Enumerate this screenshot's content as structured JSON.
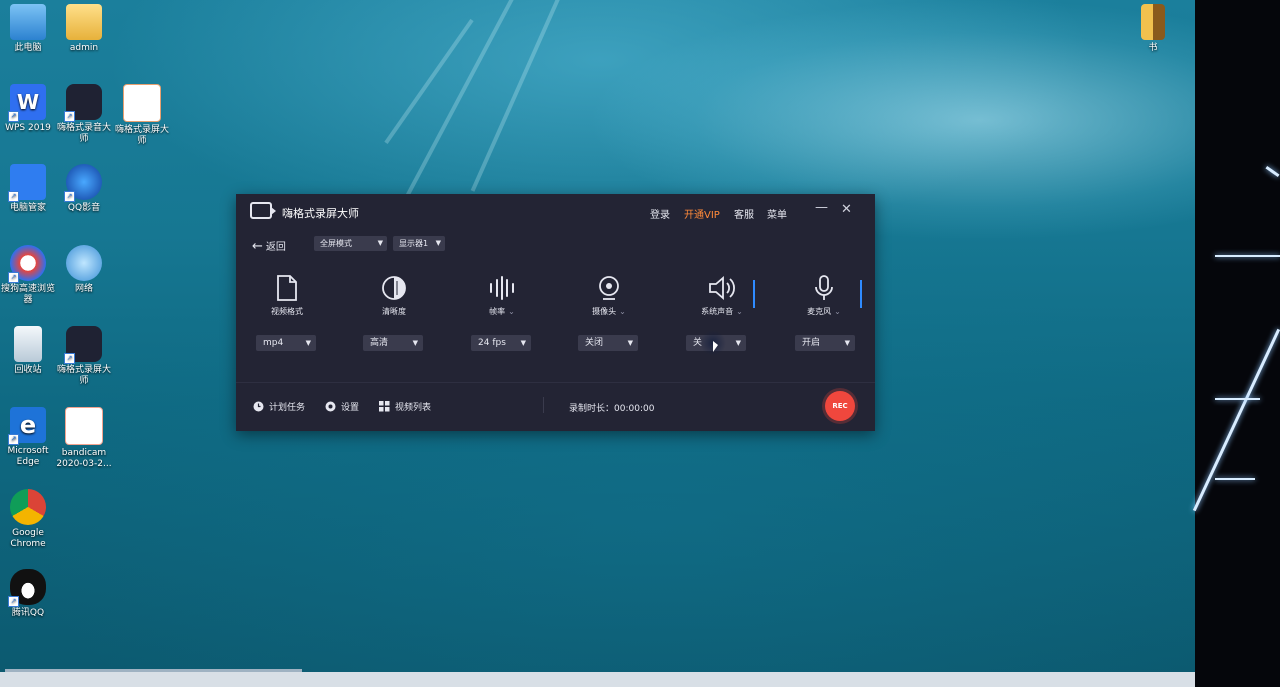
{
  "desktop": {
    "icons": [
      {
        "label": "此电脑",
        "name": "this-pc-icon",
        "color": "#4aa3f0"
      },
      {
        "label": "admin",
        "name": "user-folder-icon",
        "color": "#f2c14e"
      },
      {
        "label": "WPS 2019",
        "name": "wps-icon",
        "color": "#2f6ff0"
      },
      {
        "label": "嗨格式录音大师",
        "name": "audio-recorder-icon",
        "color": "#1f2233"
      },
      {
        "label": "嗨格式录屏大师",
        "name": "pdf-file-icon",
        "color": "#ffffff"
      },
      {
        "label": "电脑管家",
        "name": "pc-manager-icon",
        "color": "#2f7df0"
      },
      {
        "label": "QQ影音",
        "name": "qq-player-icon",
        "color": "#1a5fd6"
      },
      {
        "label": "搜狗高速浏览器",
        "name": "sogou-browser-icon",
        "color": "#e8453c"
      },
      {
        "label": "网络",
        "name": "network-icon",
        "color": "#5bb6f0"
      },
      {
        "label": "回收站",
        "name": "recycle-bin-icon",
        "color": "#d8e6f2"
      },
      {
        "label": "嗨格式录屏大师",
        "name": "screen-recorder-icon",
        "color": "#1f2233"
      },
      {
        "label": "Microsoft Edge",
        "name": "edge-icon",
        "color": "#1e73d8"
      },
      {
        "label": "bandicam 2020-03-2...",
        "name": "bandicam-file-icon",
        "color": "#f2a38f"
      },
      {
        "label": "Google Chrome",
        "name": "chrome-icon",
        "color": "#ffffff"
      },
      {
        "label": "腾讯QQ",
        "name": "qq-icon",
        "color": "#111111"
      },
      {
        "label": "书",
        "name": "book-shortcut-icon",
        "color": "#f2c14e"
      }
    ]
  },
  "app": {
    "title": "嗨格式录屏大师",
    "header": {
      "login": "登录",
      "vip": "开通VIP",
      "service": "客服",
      "menu": "菜单",
      "minimize": "—",
      "close": "✕"
    },
    "toolbar": {
      "back": "返回",
      "mode": "全屏模式",
      "display": "显示器1"
    },
    "options": [
      {
        "label": "视频格式",
        "value": "mp4"
      },
      {
        "label": "清晰度",
        "value": "高清"
      },
      {
        "label": "帧率",
        "value": "24 fps"
      },
      {
        "label": "摄像头",
        "value": "关闭"
      },
      {
        "label": "系统声音",
        "value": "关"
      },
      {
        "label": "麦克风",
        "value": "开启"
      }
    ],
    "footer": {
      "schedule": "计划任务",
      "settings": "设置",
      "video_list": "视频列表",
      "duration_label": "录制时长：",
      "duration": "00:00:00",
      "rec": "REC"
    },
    "colors": {
      "window_bg": "#232434",
      "vip": "#ff8a3a",
      "rec": "#f0473d",
      "accent": "#2f8bff"
    }
  }
}
